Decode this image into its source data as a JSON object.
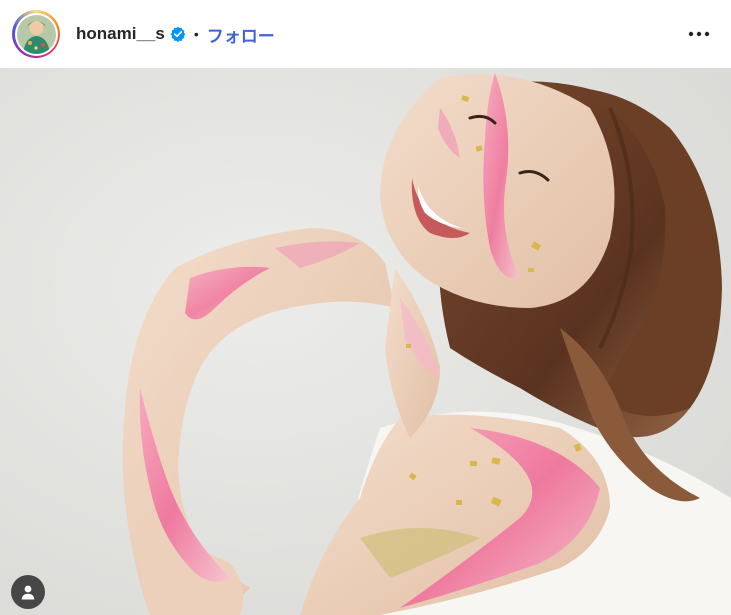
{
  "header": {
    "username": "honami__s",
    "separator": "•",
    "follow_label": "フォロー"
  },
  "icons": {
    "avatar": "profile-avatar",
    "verified": "verified-badge-icon",
    "more": "more-options-icon",
    "user_tag": "user-tag-icon"
  },
  "colors": {
    "follow_text": "#3e64d8",
    "verified_badge": "#0095f6",
    "photo_background": "#e5e5e3",
    "paint_pink": "#f06a9a"
  }
}
